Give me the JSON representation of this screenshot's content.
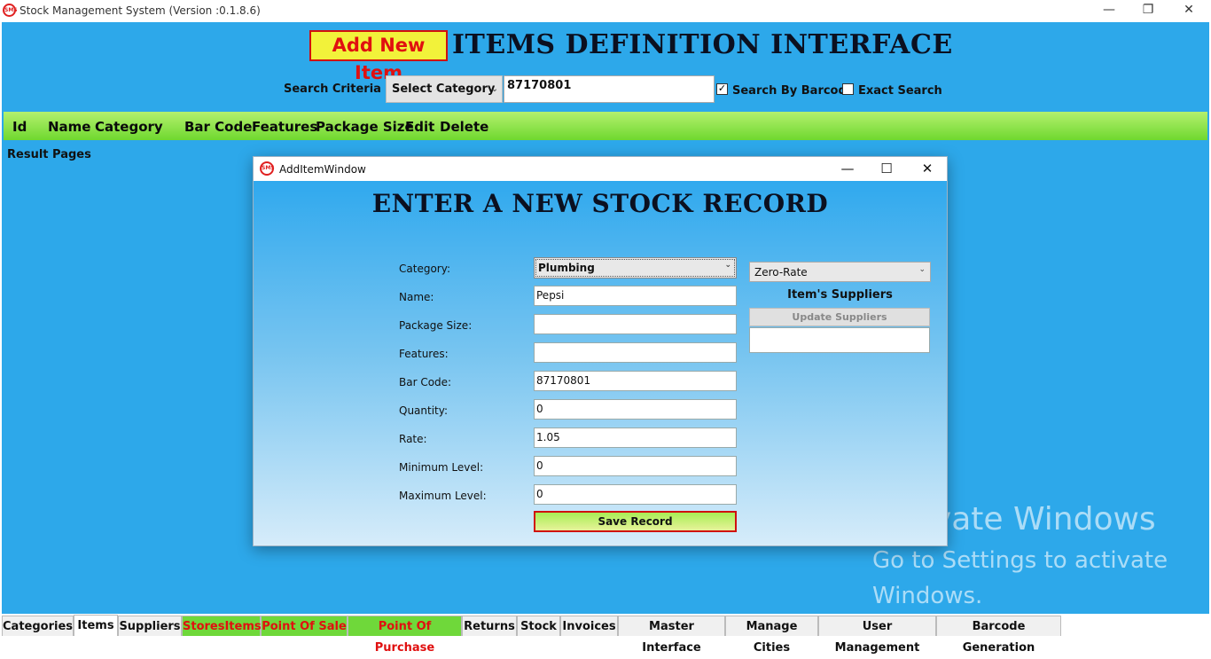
{
  "window": {
    "title": "Stock Management System (Version :0.1.8.6)",
    "logo_text": "SMS",
    "controls": {
      "minimize": "—",
      "restore": "❐",
      "close": "✕"
    }
  },
  "header": {
    "add_button": "Add New Item",
    "title": "ITEMS DEFINITION INTERFACE"
  },
  "search": {
    "label": "Search Criteria",
    "category_select": "Select Category",
    "barcode_value": "87170801",
    "by_barcode_label": "Search By Barcode",
    "by_barcode_checked": true,
    "exact_label": "Exact Search",
    "exact_checked": false
  },
  "table": {
    "columns": [
      "Id",
      "Name",
      "Category",
      "Bar Code",
      "Features",
      "Package Size",
      "Edit",
      "Delete"
    ]
  },
  "result_pages_label": "Result Pages",
  "watermark": {
    "line1": "Activate Windows",
    "line2": "Go to Settings to activate",
    "line3": "Windows."
  },
  "dialog": {
    "title": "AddItemWindow",
    "logo_text": "SMS",
    "controls": {
      "minimize": "—",
      "maximize": "☐",
      "close": "✕"
    },
    "heading": "ENTER A NEW STOCK RECORD",
    "fields": {
      "category_label": "Category:",
      "category_value": "Plumbing",
      "name_label": "Name:",
      "name_value": "Pepsi",
      "package_label": "Package Size:",
      "package_value": "",
      "features_label": "Features:",
      "features_value": "",
      "barcode_label": "Bar Code:",
      "barcode_value": "87170801",
      "quantity_label": "Quantity:",
      "quantity_value": "0",
      "rate_label": "Rate:",
      "rate_value": "1.05",
      "min_label": "Minimum Level:",
      "min_value": "0",
      "max_label": "Maximum Level:",
      "max_value": "0"
    },
    "tax_select": "Zero-Rate",
    "suppliers_label": "Item's Suppliers",
    "update_suppliers": "Update Suppliers",
    "save_button": "Save Record"
  },
  "tabs": [
    {
      "label": "Categories"
    },
    {
      "label": "Items",
      "selected": true
    },
    {
      "label": "Suppliers"
    },
    {
      "label": "StoresItems",
      "highlight": true
    },
    {
      "label": "Point Of Sale",
      "highlight": true
    },
    {
      "label": "Point Of Purchase",
      "highlight": true
    },
    {
      "label": "Returns"
    },
    {
      "label": "Stock"
    },
    {
      "label": "Invoices"
    },
    {
      "label": "Master Interface"
    },
    {
      "label": "Manage Cities"
    },
    {
      "label": "User Management"
    },
    {
      "label": "Barcode Generation"
    }
  ],
  "colors": {
    "main_bg": "#2da8ea",
    "header_row": "#6fd82f",
    "accent_red": "#e01010",
    "add_button_bg": "#f2f23a"
  }
}
